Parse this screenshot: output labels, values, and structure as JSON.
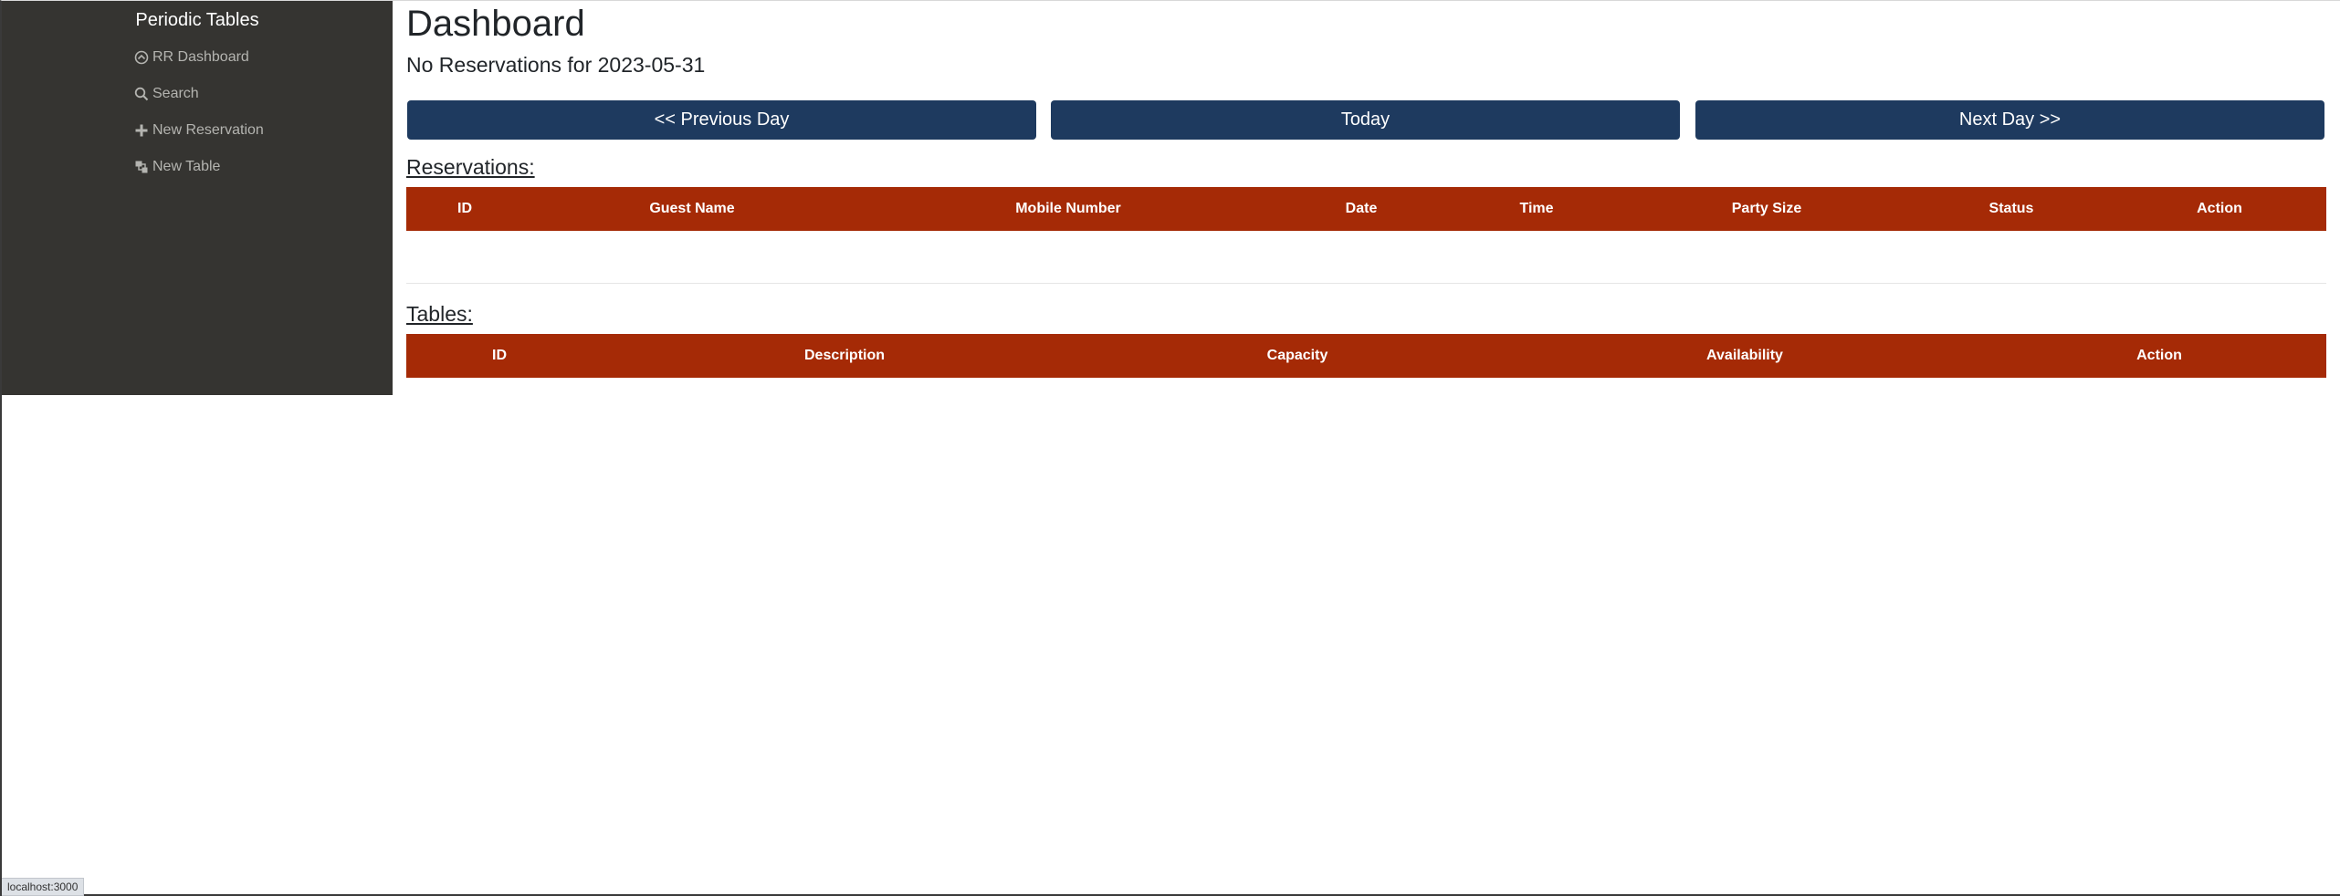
{
  "sidebar": {
    "brand": "Periodic Tables",
    "items": [
      {
        "label": "RR Dashboard",
        "icon": "dashboard-icon"
      },
      {
        "label": "Search",
        "icon": "search-icon"
      },
      {
        "label": "New Reservation",
        "icon": "plus-icon"
      },
      {
        "label": "New Table",
        "icon": "layers-icon"
      }
    ]
  },
  "main": {
    "title": "Dashboard",
    "subtitle": "No Reservations for 2023-05-31",
    "buttons": {
      "previous": "<< Previous Day",
      "today": "Today",
      "next": "Next Day >>"
    },
    "reservations": {
      "title": "Reservations:",
      "columns": [
        "ID",
        "Guest Name",
        "Mobile Number",
        "Date",
        "Time",
        "Party Size",
        "Status",
        "Action"
      ]
    },
    "tables": {
      "title": "Tables:",
      "columns": [
        "ID",
        "Description",
        "Capacity",
        "Availability",
        "Action"
      ]
    }
  },
  "status_bar": {
    "url": "localhost:3000"
  },
  "colors": {
    "sidebar_bg": "#353431",
    "button_bg": "#1e3a5f",
    "table_header_bg": "#a52a06"
  }
}
